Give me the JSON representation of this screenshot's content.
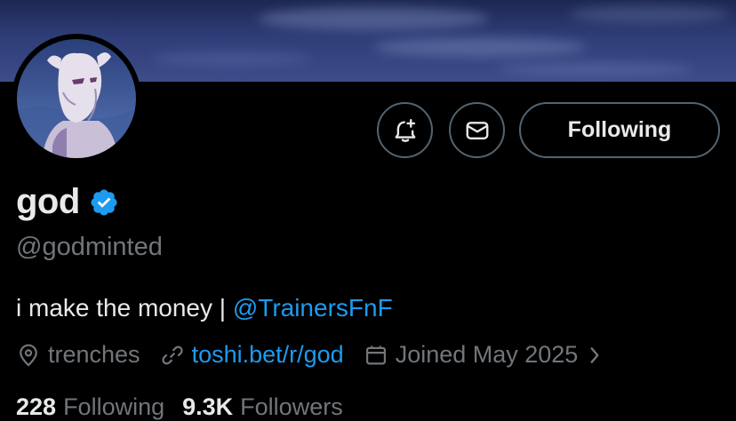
{
  "colors": {
    "background": "#000000",
    "primary_text": "#e7e9ea",
    "secondary_text": "#71767b",
    "link": "#1d9bf0",
    "button_border": "#536471",
    "verified_badge": "#1d9bf0"
  },
  "profile": {
    "display_name": "god",
    "verified": true,
    "handle": "@godminted",
    "bio_text": "i make the money | ",
    "bio_mention": "@TrainersFnF",
    "location": "trenches",
    "website": "toshi.bet/r/god",
    "joined": "Joined May 2025"
  },
  "actions": {
    "notify_icon": "bell-plus-icon",
    "message_icon": "envelope-icon",
    "follow_label": "Following"
  },
  "stats": {
    "following_count": "228",
    "following_label": "Following",
    "followers_count": "9.3K",
    "followers_label": "Followers"
  }
}
